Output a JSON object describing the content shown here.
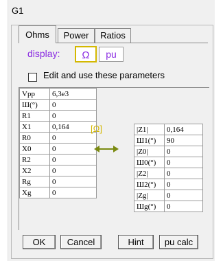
{
  "window": {
    "title": "G1"
  },
  "tabs": [
    {
      "label": "Ohms",
      "active": true
    },
    {
      "label": "Power",
      "active": false
    },
    {
      "label": "Ratios",
      "active": false
    }
  ],
  "display": {
    "label": "display:",
    "ohm_button": "Ω",
    "pu_button": "pu",
    "selected": "Ω"
  },
  "edit_checkbox": {
    "label": "Edit and use these parameters",
    "checked": false
  },
  "left_params": [
    {
      "label": "Vpp",
      "value": "6,3e3"
    },
    {
      "label": "Ш(°)",
      "value": "0"
    },
    {
      "label": "R1",
      "value": "0"
    },
    {
      "label": "X1",
      "value": "0,164"
    },
    {
      "label": "R0",
      "value": "0"
    },
    {
      "label": "X0",
      "value": "0"
    },
    {
      "label": "R2",
      "value": "0"
    },
    {
      "label": "X2",
      "value": "0"
    },
    {
      "label": "Rg",
      "value": "0"
    },
    {
      "label": "Xg",
      "value": "0"
    }
  ],
  "unit_label": "[Ω]",
  "right_params": [
    {
      "label": "|Z1|",
      "value": "0,164"
    },
    {
      "label": "Ш1(°)",
      "value": "90"
    },
    {
      "label": "|Z0|",
      "value": "0"
    },
    {
      "label": "Ш0(°)",
      "value": "0"
    },
    {
      "label": "|Z2|",
      "value": "0"
    },
    {
      "label": "Ш2(°)",
      "value": "0"
    },
    {
      "label": "|Zg|",
      "value": "0"
    },
    {
      "label": "Шg(°)",
      "value": "0"
    }
  ],
  "buttons": {
    "ok": "OK",
    "cancel": "Cancel",
    "hint": "Hint",
    "pu_calc": "pu calc"
  },
  "colors": {
    "accent": "#8a2be2",
    "highlight": "#d4b800",
    "arrow": "#7a8a10"
  }
}
